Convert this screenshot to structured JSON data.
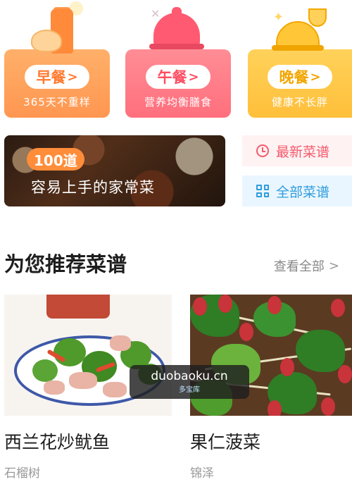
{
  "meals": [
    {
      "label": "早餐",
      "subtitle": "365天不重样",
      "chevron": ">"
    },
    {
      "label": "午餐",
      "subtitle": "营养均衡膳食",
      "chevron": ">"
    },
    {
      "label": "晚餐",
      "subtitle": "健康不长胖",
      "chevron": ">"
    }
  ],
  "promo": {
    "badge": "100道",
    "title": "容易上手的家常菜"
  },
  "quick_links": [
    {
      "label": "最新菜谱",
      "icon": "clock-icon",
      "color": "#f45b6d"
    },
    {
      "label": "全部菜谱",
      "icon": "grid-icon",
      "color": "#2f9ddd"
    }
  ],
  "recommend": {
    "title": "为您推荐菜谱",
    "see_all": "查看全部",
    "chevron": ">",
    "recipes": [
      {
        "name": "西兰花炒鱿鱼",
        "author": "石榴树"
      },
      {
        "name": "果仁菠菜",
        "author": "锦泽"
      }
    ]
  },
  "watermark": {
    "main": "duobaoku.cn",
    "sub": "多宝库"
  },
  "colors": {
    "breakfast": "#ff9650",
    "lunch": "#ff6f7d",
    "dinner": "#ffbf3a",
    "accent": "#ff8d3a"
  }
}
